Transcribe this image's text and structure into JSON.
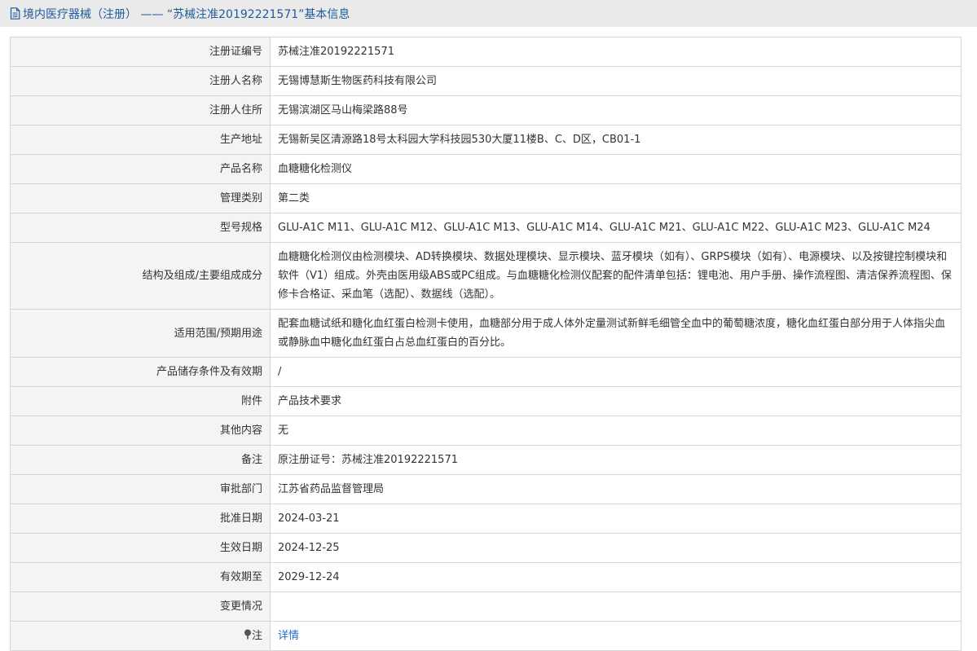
{
  "page": {
    "title": "境内医疗器械（注册） —— “苏械注准20192221571”基本信息"
  },
  "rows": [
    {
      "label": "注册证编号",
      "value": "苏械注准20192221571"
    },
    {
      "label": "注册人名称",
      "value": "无锡博慧斯生物医药科技有限公司"
    },
    {
      "label": "注册人住所",
      "value": "无锡滨湖区马山梅梁路88号"
    },
    {
      "label": "生产地址",
      "value": "无锡新吴区清源路18号太科园大学科技园530大厦11楼B、C、D区，CB01-1"
    },
    {
      "label": "产品名称",
      "value": "血糖糖化检测仪"
    },
    {
      "label": "管理类别",
      "value": "第二类"
    },
    {
      "label": "型号规格",
      "value": "GLU-A1C M11、GLU-A1C M12、GLU-A1C M13、GLU-A1C M14、GLU-A1C M21、GLU-A1C M22、GLU-A1C M23、GLU-A1C M24"
    },
    {
      "label": "结构及组成/主要组成成分",
      "value": "血糖糖化检测仪由检测模块、AD转换模块、数据处理模块、显示模块、蓝牙模块（如有）、GRPS模块（如有）、电源模块、以及按键控制模块和软件（V1）组成。外壳由医用级ABS或PC组成。与血糖糖化检测仪配套的配件清单包括：锂电池、用户手册、操作流程图、清洁保养流程图、保修卡合格证、采血笔（选配）、数据线（选配）。"
    },
    {
      "label": "适用范围/预期用途",
      "value": "配套血糖试纸和糖化血红蛋白检测卡使用，血糖部分用于成人体外定量测试新鲜毛细管全血中的葡萄糖浓度，糖化血红蛋白部分用于人体指尖血或静脉血中糖化血红蛋白占总血红蛋白的百分比。"
    },
    {
      "label": "产品储存条件及有效期",
      "value": "/"
    },
    {
      "label": "附件",
      "value": "产品技术要求"
    },
    {
      "label": "其他内容",
      "value": "无"
    },
    {
      "label": "备注",
      "value": "原注册证号：苏械注准20192221571"
    },
    {
      "label": "审批部门",
      "value": "江苏省药品监督管理局"
    },
    {
      "label": "批准日期",
      "value": "2024-03-21"
    },
    {
      "label": "生效日期",
      "value": "2024-12-25"
    },
    {
      "label": "有效期至",
      "value": "2029-12-24"
    },
    {
      "label": "变更情况",
      "value": ""
    }
  ],
  "note_row": {
    "label": "注",
    "link_text": "详情"
  }
}
